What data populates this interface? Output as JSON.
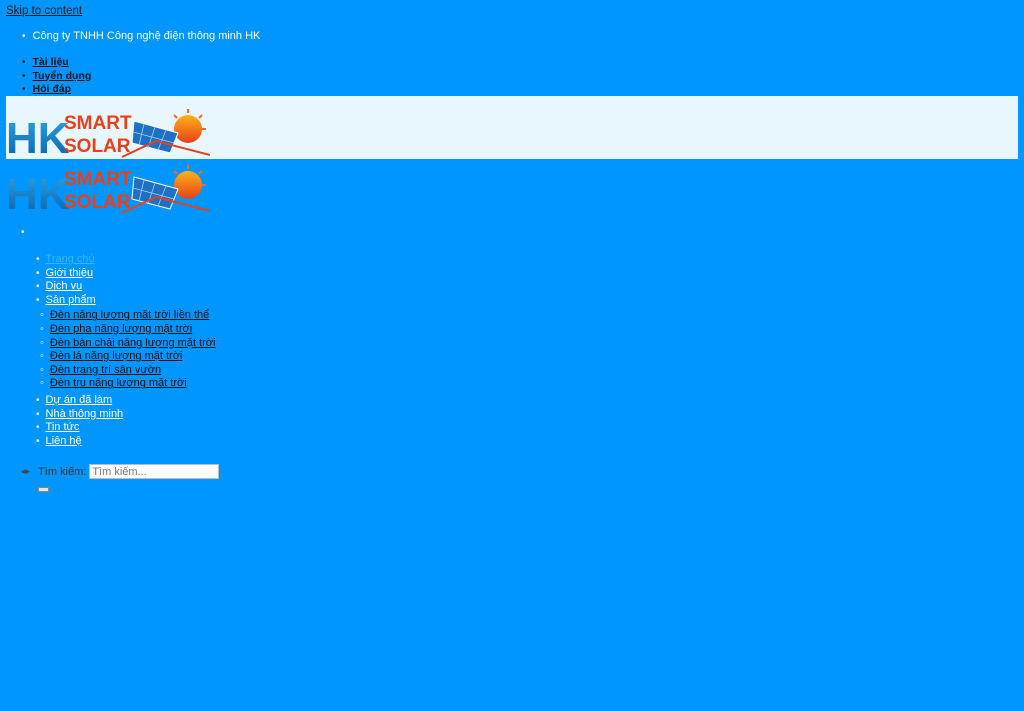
{
  "skip_link": "Skip to content",
  "topbar": {
    "company": "Công ty TNHH Công nghệ điện thông minh HK"
  },
  "top_links": [
    "Tài liệu",
    "Tuyển dụng",
    "Hỏi đáp"
  ],
  "logo": {
    "line1": "HK",
    "line2": "SMART",
    "line3": "SOLAR"
  },
  "menu": {
    "home": "Trang chủ",
    "about": "Giới thiệu",
    "services": "Dịch vụ",
    "products": "Sản phẩm",
    "product_items": [
      "Đèn năng lượng mặt trời liền thể",
      "Đèn pha năng lượng mặt trời",
      "Đèn bàn chải năng lượng mặt trời",
      "Đèn lá năng lượng mặt trời",
      "Đèn trang trí sân vườn",
      "Đèn trụ năng lượng mặt trời"
    ],
    "projects": "Dự án đã làm",
    "smart_home": "Nhà thông minh",
    "news": "Tin tức",
    "contact": "Liên hệ"
  },
  "search": {
    "label": "Tìm kiếm:",
    "placeholder": "Tìm kiếm..."
  },
  "colors": {
    "page_bg": "#0096ff",
    "header_band": "#e8f6fd",
    "active_link": "#37b7ff"
  }
}
